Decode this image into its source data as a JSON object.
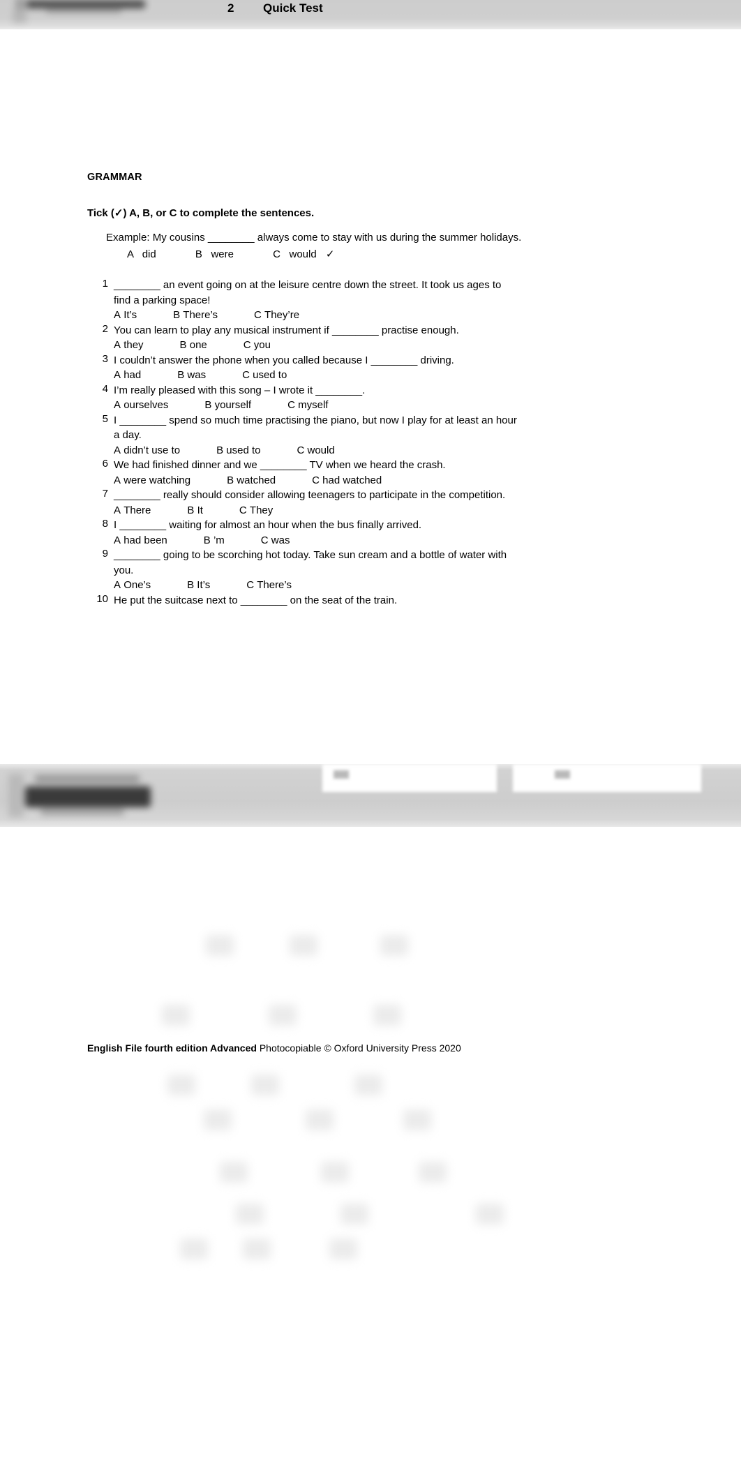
{
  "header": {
    "unit_number": "2",
    "title": "Quick Test",
    "logo_alt": "english-file-logo"
  },
  "section": {
    "heading": "GRAMMAR",
    "instruction": "Tick (✓) A, B, or C to complete the sentences."
  },
  "example": {
    "stem": "Example: My cousins ________ always come to stay with us during the summer holidays.",
    "options": [
      {
        "letter": "A",
        "text": "did",
        "ticked": false
      },
      {
        "letter": "B",
        "text": "were",
        "ticked": false
      },
      {
        "letter": "C",
        "text": "would",
        "ticked": true
      }
    ],
    "tick_glyph": "✓"
  },
  "questions": [
    {
      "number": "1",
      "stem_lines": [
        "________ an event going on at the leisure centre down the street. It took us ages to",
        "find a parking space!"
      ],
      "options": [
        {
          "letter": "A",
          "text": "It’s"
        },
        {
          "letter": "B",
          "text": "There’s"
        },
        {
          "letter": "C",
          "text": "They’re"
        }
      ]
    },
    {
      "number": "2",
      "stem_lines": [
        "You can learn to play any musical instrument if ________ practise enough."
      ],
      "options": [
        {
          "letter": "A",
          "text": "they"
        },
        {
          "letter": "B",
          "text": "one"
        },
        {
          "letter": "C",
          "text": "you"
        }
      ]
    },
    {
      "number": "3",
      "stem_lines": [
        "I couldn’t answer the phone when you called because I ________ driving."
      ],
      "options": [
        {
          "letter": "A",
          "text": "had"
        },
        {
          "letter": "B",
          "text": "was"
        },
        {
          "letter": "C",
          "text": "used to"
        }
      ]
    },
    {
      "number": "4",
      "stem_lines": [
        "I’m really pleased with this song – I wrote it ________."
      ],
      "options": [
        {
          "letter": "A",
          "text": "ourselves"
        },
        {
          "letter": "B",
          "text": "yourself"
        },
        {
          "letter": "C",
          "text": "myself"
        }
      ]
    },
    {
      "number": "5",
      "stem_lines": [
        "I ________ spend so much time practising the piano, but now I play for at least an hour",
        "a day."
      ],
      "options": [
        {
          "letter": "A",
          "text": "didn’t use to"
        },
        {
          "letter": "B",
          "text": "used to"
        },
        {
          "letter": "C",
          "text": "would"
        }
      ]
    },
    {
      "number": "6",
      "stem_lines": [
        "We had finished dinner and we ________ TV when we heard the crash."
      ],
      "options": [
        {
          "letter": "A",
          "text": "were watching"
        },
        {
          "letter": "B",
          "text": "watched"
        },
        {
          "letter": "C",
          "text": "had watched"
        }
      ]
    },
    {
      "number": "7",
      "stem_lines": [
        "________ really should consider allowing teenagers to participate in the competition."
      ],
      "options": [
        {
          "letter": "A",
          "text": "There"
        },
        {
          "letter": "B",
          "text": "It"
        },
        {
          "letter": "C",
          "text": "They"
        }
      ]
    },
    {
      "number": "8",
      "stem_lines": [
        "I ________ waiting for almost an hour when the bus finally arrived."
      ],
      "options": [
        {
          "letter": "A",
          "text": "had been"
        },
        {
          "letter": "B",
          "text": "’m"
        },
        {
          "letter": "C",
          "text": "was"
        }
      ]
    },
    {
      "number": "9",
      "stem_lines": [
        "________ going to be scorching hot today. Take sun cream and a bottle of water with",
        "you."
      ],
      "options": [
        {
          "letter": "A",
          "text": "One’s"
        },
        {
          "letter": "B",
          "text": "It’s"
        },
        {
          "letter": "C",
          "text": "There’s"
        }
      ]
    },
    {
      "number": "10",
      "stem_lines": [
        "He put the suitcase next to ________ on the seat of the train."
      ],
      "options": []
    }
  ],
  "footer": {
    "logo_alt": "english-file-logo",
    "copyright_bold": "English File fourth edition Advanced",
    "copyright_rest": " Photocopiable © Oxford University Press 2020"
  },
  "colors": {
    "band_gray": "#cfcfcf",
    "text": "#000000",
    "page_bg": "#ffffff"
  }
}
